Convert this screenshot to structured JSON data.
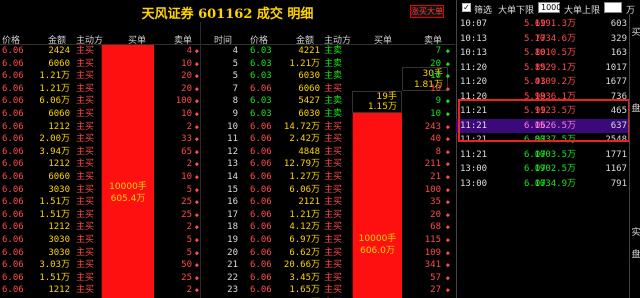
{
  "window": {
    "title": "天风证券 601162 成交 明细",
    "report_button": "涨买大单"
  },
  "left_headers": [
    "价格",
    "金额",
    "主动方",
    "买单",
    "卖单"
  ],
  "mid_headers": [
    "时间",
    "价格",
    "金额",
    "主动方",
    "买单",
    "卖单"
  ],
  "left_rows": [
    {
      "price": "6.06",
      "amount": "2424",
      "dir": "主买",
      "sell": "4"
    },
    {
      "price": "6.06",
      "amount": "6060",
      "dir": "主买",
      "sell": "10"
    },
    {
      "price": "6.06",
      "amount": "1.21万",
      "dir": "主买",
      "sell": "20"
    },
    {
      "price": "6.06",
      "amount": "1.21万",
      "dir": "主买",
      "sell": "20"
    },
    {
      "price": "6.06",
      "amount": "6.06万",
      "dir": "主买",
      "sell": "100"
    },
    {
      "price": "6.06",
      "amount": "6060",
      "dir": "主买",
      "sell": "10"
    },
    {
      "price": "6.06",
      "amount": "1212",
      "dir": "主买",
      "sell": "2"
    },
    {
      "price": "6.06",
      "amount": "2.00万",
      "dir": "主买",
      "sell": "33"
    },
    {
      "price": "6.06",
      "amount": "3.94万",
      "dir": "主买",
      "sell": "65"
    },
    {
      "price": "6.06",
      "amount": "1212",
      "dir": "主买",
      "sell": "2"
    },
    {
      "price": "6.06",
      "amount": "6060",
      "dir": "主买",
      "sell": "10"
    },
    {
      "price": "6.06",
      "amount": "3030",
      "dir": "主买",
      "sell": "5"
    },
    {
      "price": "6.06",
      "amount": "1.51万",
      "dir": "主买",
      "sell": "25"
    },
    {
      "price": "6.06",
      "amount": "1.51万",
      "dir": "主买",
      "sell": "25"
    },
    {
      "price": "6.06",
      "amount": "1212",
      "dir": "主买",
      "sell": "2"
    },
    {
      "price": "6.06",
      "amount": "3030",
      "dir": "主买",
      "sell": "5"
    },
    {
      "price": "6.06",
      "amount": "3030",
      "dir": "主买",
      "sell": "5"
    },
    {
      "price": "6.06",
      "amount": "3.03万",
      "dir": "主买",
      "sell": "50"
    },
    {
      "price": "6.06",
      "amount": "1.51万",
      "dir": "主买",
      "sell": "25"
    },
    {
      "price": "6.06",
      "amount": "1212",
      "dir": "主买",
      "sell": "2"
    }
  ],
  "left_big_order": {
    "volume": "10000手",
    "amount": "605.4万"
  },
  "mid_rows": [
    {
      "time": "4",
      "price": "6.03",
      "amount": "4221",
      "dir": "主卖",
      "dir_side": "sell",
      "buy": "",
      "sell": "7"
    },
    {
      "time": "5",
      "price": "6.03",
      "amount": "1.21万",
      "dir": "主卖",
      "dir_side": "sell",
      "buy": "",
      "sell": "20"
    },
    {
      "time": "5",
      "price": "6.03",
      "amount": "6030",
      "dir": "主卖",
      "dir_side": "sell",
      "buy": "",
      "sell": "10"
    },
    {
      "time": "7",
      "price": "6.06",
      "amount": "6060",
      "dir": "主买",
      "dir_side": "buy",
      "buy": "",
      "sell": "10"
    },
    {
      "time": "8",
      "price": "6.03",
      "amount": "5427",
      "dir": "主卖",
      "dir_side": "sell",
      "buy": "",
      "sell": "9"
    },
    {
      "time": "9",
      "price": "6.03",
      "amount": "6030",
      "dir": "主卖",
      "dir_side": "sell",
      "buy": "",
      "sell": "10"
    },
    {
      "time": "10",
      "price": "6.06",
      "amount": "14.72万",
      "dir": "主买",
      "dir_side": "buy",
      "buy": "",
      "sell": "243"
    },
    {
      "time": "11",
      "price": "6.06",
      "amount": "2.42万",
      "dir": "主买",
      "dir_side": "buy",
      "buy": "",
      "sell": "40"
    },
    {
      "time": "12",
      "price": "6.06",
      "amount": "4848",
      "dir": "主买",
      "dir_side": "buy",
      "buy": "",
      "sell": "8"
    },
    {
      "time": "13",
      "price": "6.06",
      "amount": "12.79万",
      "dir": "主买",
      "dir_side": "buy",
      "buy": "",
      "sell": "211"
    },
    {
      "time": "14",
      "price": "6.06",
      "amount": "1.27万",
      "dir": "主买",
      "dir_side": "buy",
      "buy": "",
      "sell": "21"
    },
    {
      "time": "15",
      "price": "6.06",
      "amount": "6.06万",
      "dir": "主买",
      "dir_side": "buy",
      "buy": "",
      "sell": "100"
    },
    {
      "time": "16",
      "price": "6.06",
      "amount": "2121",
      "dir": "主买",
      "dir_side": "buy",
      "buy": "",
      "sell": "35"
    },
    {
      "time": "17",
      "price": "6.06",
      "amount": "1.21万",
      "dir": "主买",
      "dir_side": "buy",
      "buy": "",
      "sell": "20"
    },
    {
      "time": "18",
      "price": "6.06",
      "amount": "4.12万",
      "dir": "主买",
      "dir_side": "buy",
      "buy": "",
      "sell": "68"
    },
    {
      "time": "19",
      "price": "6.06",
      "amount": "6.97万",
      "dir": "主买",
      "dir_side": "buy",
      "buy": "",
      "sell": "115"
    },
    {
      "time": "20",
      "price": "6.06",
      "amount": "6.62万",
      "dir": "主买",
      "dir_side": "buy",
      "buy": "",
      "sell": "109"
    },
    {
      "time": "21",
      "price": "6.06",
      "amount": "20.66万",
      "dir": "主买",
      "dir_side": "buy",
      "buy": "",
      "sell": "341"
    },
    {
      "time": "22",
      "price": "6.06",
      "amount": "3.45万",
      "dir": "主买",
      "dir_side": "buy",
      "buy": "",
      "sell": "57"
    },
    {
      "time": "23",
      "price": "6.06",
      "amount": "1.65万",
      "dir": "主买",
      "dir_side": "buy",
      "buy": "",
      "sell": "27"
    },
    {
      "time": "24",
      "price": "6.06",
      "amount": "7.66万",
      "dir": "主买",
      "dir_side": "buy",
      "buy": "",
      "sell": "126"
    }
  ],
  "mid_mini_boxes": [
    {
      "line1": "30手",
      "line2": "1.81万"
    },
    {
      "line1": "19手",
      "line2": "1.15万"
    }
  ],
  "mid_big_order": {
    "volume": "10000手",
    "amount": "606.0万"
  },
  "right_filter": {
    "checkbox": "✓",
    "filter_label": "筛选",
    "lower_label": "大单下限",
    "lower_value": "1000",
    "upper_label": "大单上限",
    "upper_value": "",
    "unit": "万"
  },
  "right_rows": [
    {
      "time": "10:07",
      "price": "5.69",
      "amount": "1191.3万",
      "vol": "603",
      "selected": false
    },
    {
      "time": "10:13",
      "price": "5.77",
      "amount": "1034.6万",
      "vol": "329",
      "selected": false
    },
    {
      "time": "10:13",
      "price": "5.80",
      "amount": "1010.5万",
      "vol": "163",
      "selected": false
    },
    {
      "time": "11:20",
      "price": "5.85",
      "amount": "1929.1万",
      "vol": "1017",
      "selected": false
    },
    {
      "time": "11:20",
      "price": "5.93",
      "amount": "4109.2万",
      "vol": "1677",
      "selected": false
    },
    {
      "time": "11:20",
      "price": "5.99",
      "amount": "1836.1万",
      "vol": "736",
      "selected": false
    },
    {
      "time": "11:21",
      "price": "5.99",
      "amount": "1123.5万",
      "vol": "465",
      "selected": false
    },
    {
      "time": "11:21",
      "price": "6.06",
      "amount": "1526.5万",
      "vol": "637",
      "selected": true
    },
    {
      "time": "11:21",
      "price": "6.07",
      "amount": "8037.5万",
      "vol": "2548",
      "selected": false
    },
    {
      "time": "11:21",
      "price": "6.07",
      "amount": "1003.5万",
      "vol": "1771",
      "selected": false
    },
    {
      "time": "13:00",
      "price": "6.07",
      "amount": "1902.5万",
      "vol": "1167",
      "selected": false
    },
    {
      "time": "13:00",
      "price": "6.07",
      "amount": "1034.9万",
      "vol": "791",
      "selected": false
    }
  ],
  "side_tabs": [
    "买",
    "盘",
    "实",
    "盘"
  ],
  "colors": {
    "up": "#ff4b4b",
    "down": "#19e619",
    "amount": "#ffd400",
    "highlight": "#ee2222",
    "selected_row": "#3b0a7a"
  }
}
